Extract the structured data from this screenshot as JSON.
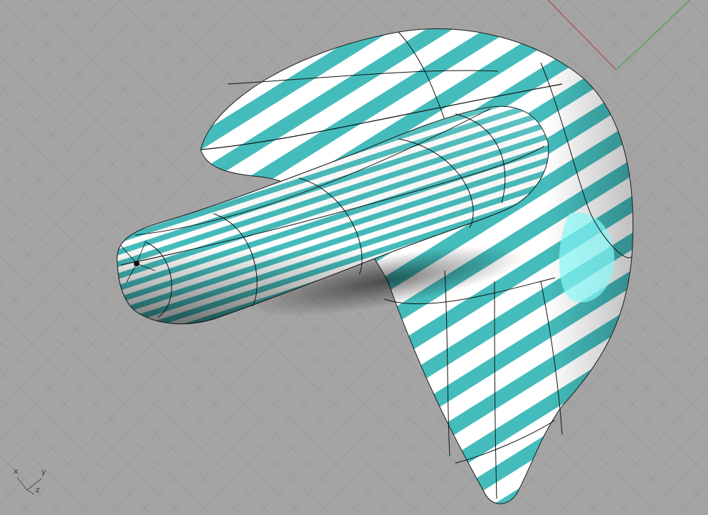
{
  "viewport": {
    "background_color": "#a4a4a4",
    "grid_color": "#9a9a9a",
    "object": "zebra-analysis-surface",
    "zebra_colors": {
      "stripe": "#45bcbc",
      "base": "#ffffff",
      "highlight": "#86f8f8"
    },
    "world_axes": {
      "x_color": "#b23a3a",
      "y_color": "#36a636"
    }
  },
  "axis_gizmo": {
    "x": "x",
    "y": "y",
    "z": "z"
  }
}
